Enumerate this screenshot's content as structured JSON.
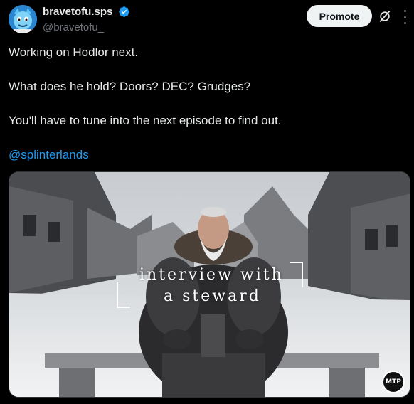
{
  "post": {
    "author": {
      "display_name": "bravetofu.sps",
      "handle": "@bravetofu_",
      "verified": true,
      "avatar_icon": "cartoon-avatar-icon"
    },
    "actions": {
      "promote_label": "Promote",
      "grok_icon": "grok-icon",
      "more_icon": "more-icon"
    },
    "text": {
      "line1": "Working on Hodlor next.",
      "line2": "What does he hold? Doors? DEC? Grudges?",
      "line3": "You'll have to tune into the next episode to find out.",
      "mention": "@splinterlands"
    },
    "media": {
      "overlay_line1": "interview with",
      "overlay_line2": "a steward",
      "badge": "MTP"
    }
  },
  "colors": {
    "background": "#000000",
    "text": "#e7e9ea",
    "secondary": "#71767b",
    "link": "#1d9bf0",
    "verified": "#1d9bf0"
  }
}
